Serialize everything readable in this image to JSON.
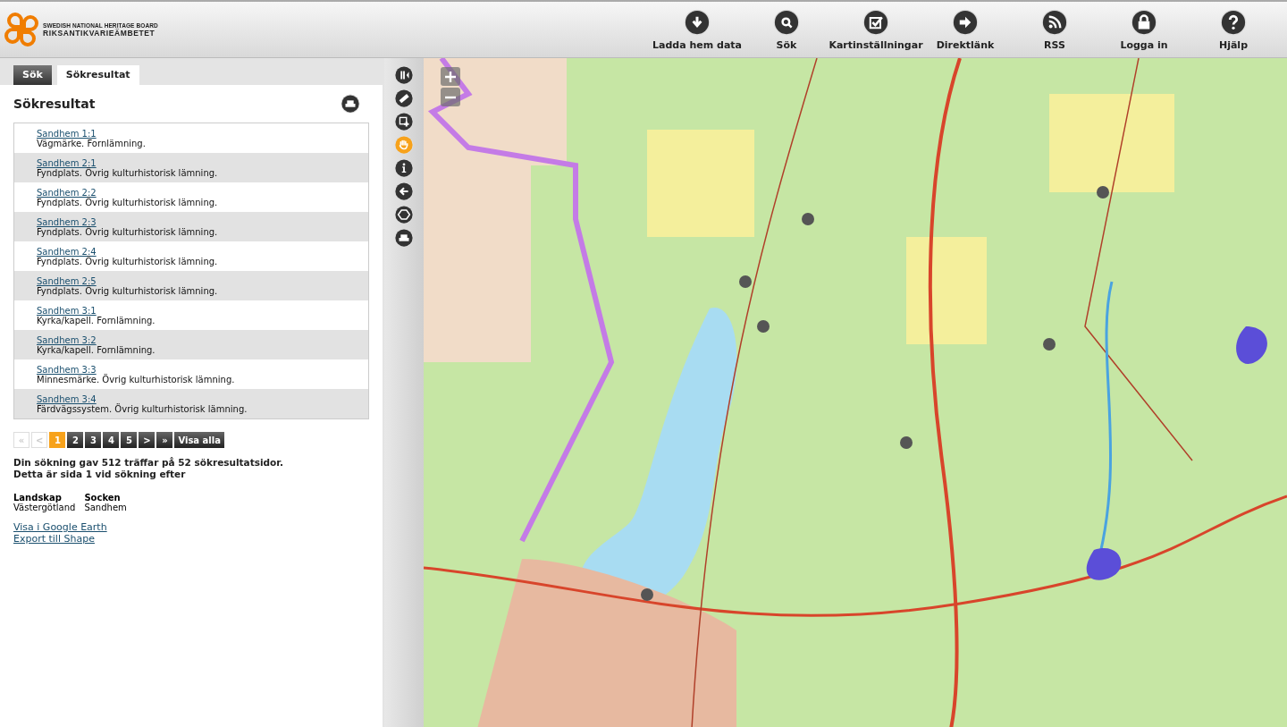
{
  "logo": {
    "line1": "SWEDISH NATIONAL HERITAGE BOARD",
    "line2": "RIKSANTIKVARIEÄMBETET"
  },
  "nav": [
    {
      "label": "Ladda hem data"
    },
    {
      "label": "Sök"
    },
    {
      "label": "Kartinställningar"
    },
    {
      "label": "Direktlänk"
    },
    {
      "label": "RSS"
    },
    {
      "label": "Logga in"
    },
    {
      "label": "Hjälp"
    }
  ],
  "tabs": [
    {
      "label": "Sök",
      "selected": false
    },
    {
      "label": "Sökresultat",
      "selected": true
    }
  ],
  "panel_title": "Sökresultat",
  "results": [
    {
      "name": "Sandhem 1:1",
      "description": "Vägmärke. Fornlämning."
    },
    {
      "name": "Sandhem 2:1",
      "description": "Fyndplats. Övrig kulturhistorisk lämning."
    },
    {
      "name": "Sandhem 2:2",
      "description": "Fyndplats. Övrig kulturhistorisk lämning."
    },
    {
      "name": "Sandhem 2:3",
      "description": "Fyndplats. Övrig kulturhistorisk lämning."
    },
    {
      "name": "Sandhem 2:4",
      "description": "Fyndplats. Övrig kulturhistorisk lämning."
    },
    {
      "name": "Sandhem 2:5",
      "description": "Fyndplats. Övrig kulturhistorisk lämning."
    },
    {
      "name": "Sandhem 3:1",
      "description": "Kyrka/kapell. Fornlämning."
    },
    {
      "name": "Sandhem 3:2",
      "description": "Kyrka/kapell. Fornlämning."
    },
    {
      "name": "Sandhem 3:3",
      "description": "Minnesmärke. Övrig kulturhistorisk lämning."
    },
    {
      "name": "Sandhem 3:4",
      "description": "Färdvägssystem. Övrig kulturhistorisk lämning."
    }
  ],
  "pagination": [
    {
      "label": "«",
      "disabled": true,
      "selected": false
    },
    {
      "label": "<",
      "disabled": true,
      "selected": false
    },
    {
      "label": "1",
      "disabled": false,
      "selected": true
    },
    {
      "label": "2",
      "disabled": false,
      "selected": false
    },
    {
      "label": "3",
      "disabled": false,
      "selected": false
    },
    {
      "label": "4",
      "disabled": false,
      "selected": false
    },
    {
      "label": "5",
      "disabled": false,
      "selected": false
    },
    {
      "label": ">",
      "disabled": false,
      "selected": false
    },
    {
      "label": "»",
      "disabled": false,
      "selected": false
    },
    {
      "label": "Visa alla",
      "disabled": false,
      "selected": false
    }
  ],
  "summary": [
    "Din sökning gav 512 träffar på 52 sökresultatsidor.",
    "Detta är sida 1 vid sökning efter"
  ],
  "criteria": [
    {
      "heading": "Landskap",
      "value": "Västergötland"
    },
    {
      "heading": "Socken",
      "value": "Sandhem"
    }
  ],
  "links": [
    "Visa i Google Earth",
    "Export till Shape"
  ],
  "tools": [
    {
      "selected": false
    },
    {
      "selected": false
    },
    {
      "selected": false
    },
    {
      "selected": true
    },
    {
      "selected": false
    },
    {
      "selected": false
    },
    {
      "selected": false
    },
    {
      "selected": false
    }
  ]
}
